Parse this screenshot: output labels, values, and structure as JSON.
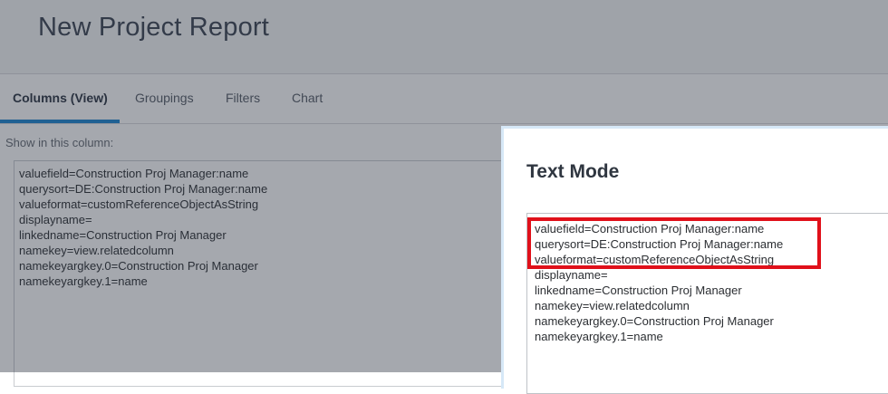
{
  "header": {
    "title": "New Project Report"
  },
  "tabs": [
    {
      "label": "Columns (View)",
      "active": true
    },
    {
      "label": "Groupings",
      "active": false
    },
    {
      "label": "Filters",
      "active": false
    },
    {
      "label": "Chart",
      "active": false
    }
  ],
  "column_editor": {
    "label": "Show in this column:",
    "lines": [
      "valuefield=Construction Proj Manager:name",
      "querysort=DE:Construction Proj Manager:name",
      "valueformat=customReferenceObjectAsString",
      "displayname=",
      "linkedname=Construction Proj Manager",
      "namekey=view.relatedcolumn",
      "namekeyargkey.0=Construction Proj Manager",
      "namekeyargkey.1=name"
    ]
  },
  "modal": {
    "title": "Text Mode",
    "lines": [
      "valuefield=Construction Proj Manager:name",
      "querysort=DE:Construction Proj Manager:name",
      "valueformat=customReferenceObjectAsString",
      "displayname=",
      "linkedname=Construction Proj Manager",
      "namekey=view.relatedcolumn",
      "namekeyargkey.0=Construction Proj Manager",
      "namekeyargkey.1=name"
    ]
  },
  "colors": {
    "accent": "#1b86d0",
    "highlight": "#e0101a",
    "overlay": "rgba(40,48,62,0.42)"
  }
}
